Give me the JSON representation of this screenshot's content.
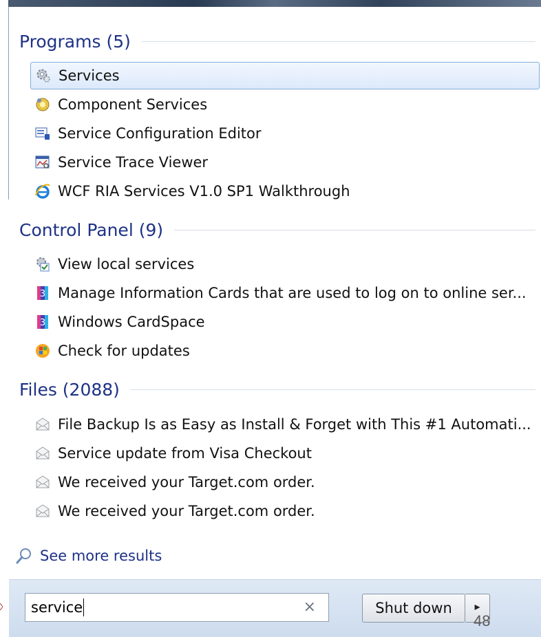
{
  "groups": [
    {
      "header": "Programs (5)",
      "items": [
        {
          "label": "Services",
          "icon": "services-gear-icon",
          "selected": true
        },
        {
          "label": "Component Services",
          "icon": "component-services-icon"
        },
        {
          "label": "Service Configuration Editor",
          "icon": "config-editor-icon"
        },
        {
          "label": "Service Trace Viewer",
          "icon": "trace-viewer-icon"
        },
        {
          "label": "WCF RIA Services V1.0 SP1 Walkthrough",
          "icon": "internet-explorer-icon"
        }
      ]
    },
    {
      "header": "Control Panel (9)",
      "items": [
        {
          "label": "View local services",
          "icon": "admin-tools-icon"
        },
        {
          "label": "Manage Information Cards that are used to log on to online ser...",
          "icon": "cardspace-icon"
        },
        {
          "label": "Windows CardSpace",
          "icon": "cardspace-icon"
        },
        {
          "label": "Check for updates",
          "icon": "windows-update-icon"
        }
      ]
    },
    {
      "header": "Files (2088)",
      "items": [
        {
          "label": "File Backup Is as Easy as Install & Forget with This #1 Automati...",
          "icon": "envelope-icon"
        },
        {
          "label": "Service update from Visa Checkout",
          "icon": "envelope-icon"
        },
        {
          "label": "We received your Target.com order.",
          "icon": "envelope-icon"
        },
        {
          "label": "We received your Target.com order.",
          "icon": "envelope-icon"
        }
      ]
    }
  ],
  "see_more": "See more results",
  "search": {
    "value": "service",
    "clear_icon": "×"
  },
  "shutdown": {
    "label": "Shut down",
    "arrow_icon": "▸"
  },
  "page_number": "48",
  "colors": {
    "header": "#1e3287",
    "selection_border": "#84acdd",
    "bottom_bar": "#dfe9f5"
  }
}
